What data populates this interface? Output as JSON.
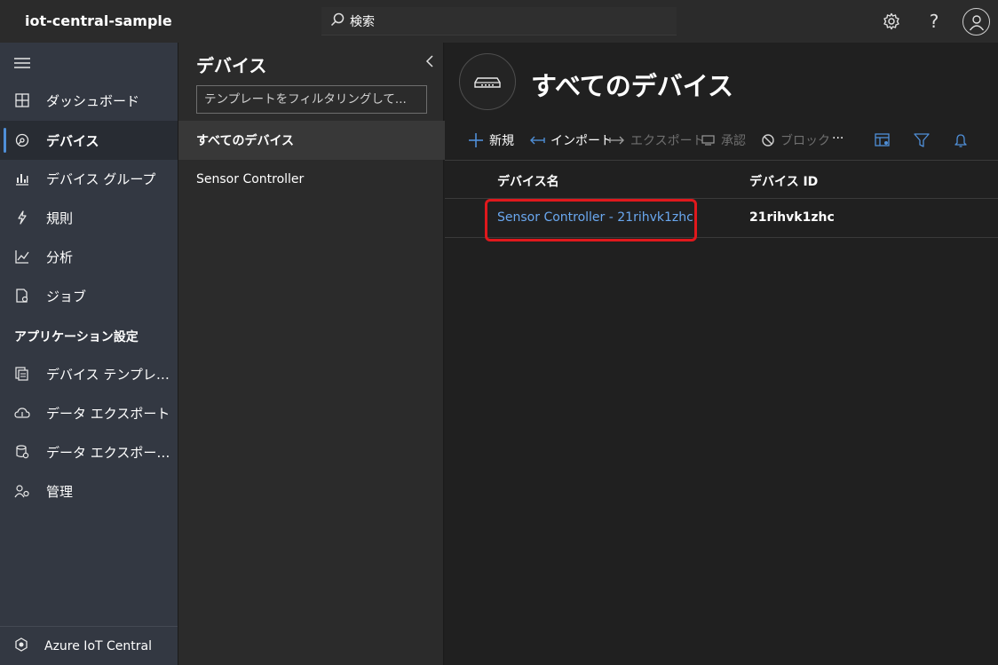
{
  "app": {
    "title": "iot-central-sample"
  },
  "search": {
    "placeholder": "検索"
  },
  "nav": {
    "items": [
      {
        "label": "ダッシュボード",
        "icon": "dashboard-icon"
      },
      {
        "label": "デバイス",
        "icon": "devices-icon",
        "active": true
      },
      {
        "label": "デバイス グループ",
        "icon": "device-groups-icon"
      },
      {
        "label": "規則",
        "icon": "rules-icon"
      },
      {
        "label": "分析",
        "icon": "analytics-icon"
      },
      {
        "label": "ジョブ",
        "icon": "jobs-icon"
      }
    ],
    "section_label": "アプリケーション設定",
    "settings_items": [
      {
        "label": "デバイス テンプレ…",
        "icon": "device-templates-icon"
      },
      {
        "label": "データ エクスポート",
        "icon": "cloud-export-icon"
      },
      {
        "label": "データ エクスポー…",
        "icon": "data-export-legacy-icon"
      },
      {
        "label": "管理",
        "icon": "administration-icon"
      }
    ],
    "footer_label": "Azure IoT Central"
  },
  "mid_panel": {
    "title": "デバイス",
    "filter_placeholder": "テンプレートをフィルタリングして...",
    "items": [
      {
        "label": "すべてのデバイス",
        "selected": true
      },
      {
        "label": "Sensor Controller"
      }
    ]
  },
  "main": {
    "title": "すべてのデバイス",
    "commands": {
      "new": "新規",
      "import": "インポート",
      "export": "エクスポート",
      "approve": "承認",
      "block": "ブロック",
      "more": "···"
    },
    "table": {
      "columns": [
        "デバイス名",
        "デバイス ID"
      ],
      "rows": [
        {
          "name": "Sensor Controller - 21rihvk1zhc",
          "id": "21rihvk1zhc"
        }
      ]
    }
  },
  "colors": {
    "accent": "#4f8fd8",
    "link": "#6aa8f0",
    "highlight": "#e0181c",
    "nav_bg": "#333842"
  }
}
